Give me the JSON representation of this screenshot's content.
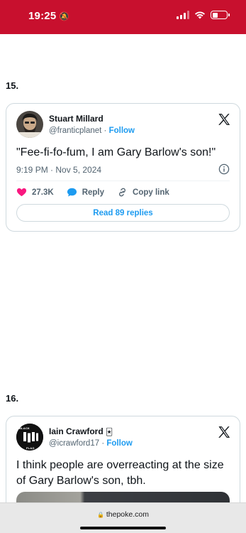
{
  "status_bar": {
    "time": "19:25",
    "battery_level": 0.4
  },
  "sections": [
    {
      "number": "15.",
      "tweet": {
        "author_name": "Stuart Millard",
        "handle": "@franticplanet",
        "separator": "·",
        "follow_label": "Follow",
        "text": "\"Fee-fi-fo-fum, I am Gary Barlow's son!\"",
        "timestamp": "9:19 PM · Nov 5, 2024",
        "likes": "27.3K",
        "reply_label": "Reply",
        "copy_link_label": "Copy link",
        "read_replies_label": "Read 89 replies"
      }
    },
    {
      "number": "16.",
      "tweet": {
        "author_name": "Iain Crawford",
        "handle": "@icrawford17",
        "separator": "·",
        "follow_label": "Follow",
        "text_lines": [
          "I think people are overreacting at the size",
          "of Gary Barlow's son, tbh."
        ],
        "avatar_text_top": "BLACK",
        "avatar_text_bottom": "FLAG"
      }
    }
  ],
  "browser": {
    "url": "thepoke.com"
  },
  "colors": {
    "status_bar": "#c8102e",
    "link": "#1d9bf0",
    "heart": "#f91880",
    "border": "#cfd9de"
  }
}
